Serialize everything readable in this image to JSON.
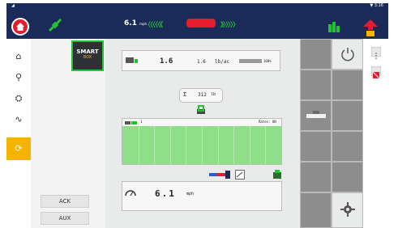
{
  "status": {
    "left_glyph": "◢",
    "time": "▼ 3:16"
  },
  "topbar": {
    "speed_value": "6.1",
    "speed_unit": "mph",
    "chevrons_left": "〈〈〈〈〈《",
    "chevrons_right": "》〉〉〉〉〉"
  },
  "sidebar": {
    "items": [
      "⌂",
      "⚲",
      "⛭",
      "∿",
      "⟳"
    ]
  },
  "smartbox": {
    "line1": "SMART",
    "line2": "BOX"
  },
  "buttons": {
    "ack": "ACK",
    "aux": "AUX"
  },
  "rate_card": {
    "actual": "1.6",
    "target": "1.6",
    "unit": "lb/ac",
    "bar_label": "100%"
  },
  "total_card": {
    "sigma": "Σ",
    "value": "312",
    "unit": "lb"
  },
  "section_card": {
    "left_label": "1",
    "right_label": "Rates: ON",
    "section_count": 10
  },
  "speed_card": {
    "value": "6.1",
    "unit": "mph"
  },
  "colors": {
    "topbar": "#1a2b5a",
    "accent_green": "#1ec032",
    "brand_red": "#e21d2f",
    "active_yellow": "#f6b400",
    "section_green": "#8ede8a"
  }
}
